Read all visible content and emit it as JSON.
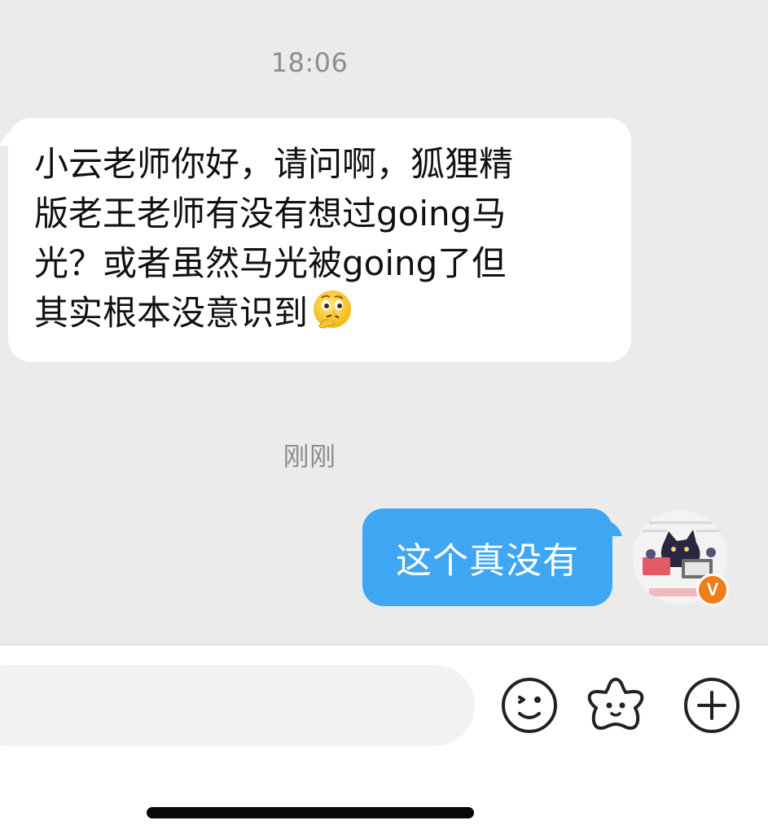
{
  "chat": {
    "timestamp_1": "18:06",
    "incoming_message": {
      "lines": [
        "小云老师你好，请问啊，狐狸精",
        "版老王老师有没有想过going马",
        "光？或者虽然马光被going了但",
        "其实根本没意识到"
      ],
      "emoji": "thinking-face"
    },
    "timestamp_2": "刚刚",
    "outgoing_message": "这个真没有",
    "avatar_badge": "V"
  },
  "input_bar": {
    "placeholder": "",
    "icons": [
      "emoji-icon",
      "sticker-icon",
      "plus-icon"
    ]
  },
  "colors": {
    "background": "#ebebeb",
    "outgoing_bubble": "#3fa6f4",
    "incoming_bubble": "#ffffff",
    "badge": "#f07c1b"
  }
}
